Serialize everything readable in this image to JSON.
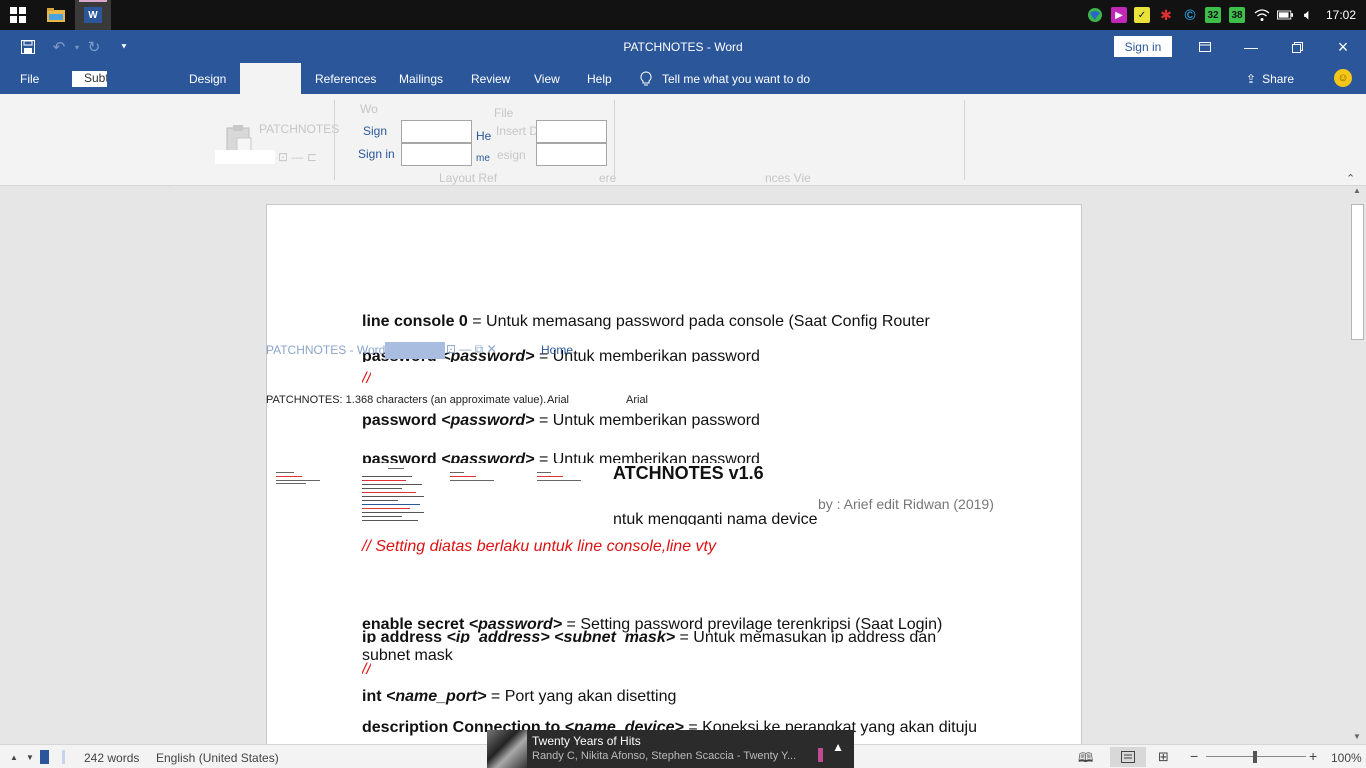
{
  "taskbar": {
    "clock": "17:02",
    "tray_badges": [
      "32",
      "38"
    ]
  },
  "titlebar": {
    "title": "PATCHNOTES  -  Word",
    "signin_label": "Sign in"
  },
  "tabs": {
    "file": "File",
    "subtab": "Subt",
    "design": "Design",
    "references": "References",
    "mailings": "Mailings",
    "review": "Review",
    "view": "View",
    "help": "Help",
    "tellme": "Tell me what you want to do",
    "share": "Share"
  },
  "ribbon_ghost": {
    "patchnotes": "PATCHNOTES",
    "wo": "Wo",
    "sign": "Sign",
    "sign_in": "Sign in",
    "file": "File",
    "he": "He",
    "insert": "Insert D",
    "me": "me",
    "design": "esign",
    "layout": "Layout Ref",
    "ere": "ere",
    "nces": "nces Vie"
  },
  "overlay": {
    "title_ghost": "PATCHNOTES  -  Word",
    "home": "Home",
    "char_count": "PATCHNOTES: 1.368 characters (an approximate value).",
    "font1": "Arial",
    "font2": "Arial"
  },
  "document": {
    "l1_bold": "line console 0",
    "l1_rest": " = Untuk memasang password pada console (Saat Config Router",
    "l2_bold": "password ",
    "l2_italic": "<password>",
    "l2_rest": " = Untuk memberikan password",
    "l3_bold": "password ",
    "l3_italic": "<password>",
    "l3_rest": " = Untuk memberikan password",
    "l4_bold": "password ",
    "l4_italic": "<password>",
    "l4_rest": " = Untuk memberikan password",
    "heading": "ATCHNOTES v1.6",
    "byline": "by : Arief edit Ridwan (2019)",
    "l5": "ntuk mengganti nama device",
    "red1": "// Setting diatas berlaku untuk line console,line vty",
    "l6_bold": "enable secret ",
    "l6_italic": "<password>",
    "l6_rest": " = Setting password previlage terenkripsi (Saat Login)",
    "l7_bold": "ip address ",
    "l7_italic": "<ip_address> <subnet_mask>",
    "l7_rest": " = Untuk memasukan ip address dan",
    "l8": "subnet mask",
    "red2": "//",
    "l9_bold": "int ",
    "l9_italic": "<name_port>",
    "l9_rest": " = Port yang akan disetting",
    "l10_bold": "description Connection to ",
    "l10_italic": "<name_device>",
    "l10_rest": " = Koneksi ke perangkat yang akan dituju",
    "red_top": "//"
  },
  "statusbar": {
    "words": "242 words",
    "language": "English (United States)",
    "zoom": "100%"
  },
  "media": {
    "title": "Twenty Years of Hits",
    "subtitle": "Randy C, Nikita Afonso, Stephen Scaccia - Twenty Y..."
  }
}
